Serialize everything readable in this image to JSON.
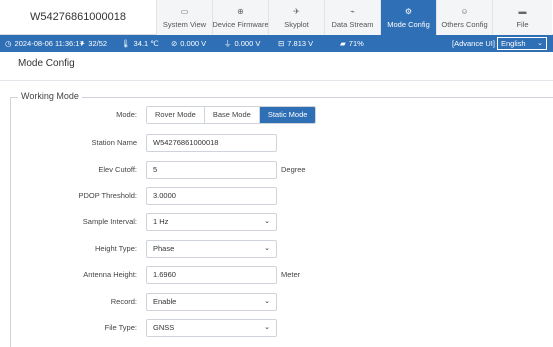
{
  "header": {
    "device_id": "W54276861000018",
    "tabs": [
      {
        "label": "System View",
        "icon": "monitor-icon",
        "glyph": "▭"
      },
      {
        "label": "Device Firmware",
        "icon": "firmware-icon",
        "glyph": "⊕"
      },
      {
        "label": "Skyplot",
        "icon": "satellite-icon",
        "glyph": "✈"
      },
      {
        "label": "Data Stream",
        "icon": "stream-icon",
        "glyph": "⌁"
      },
      {
        "label": "Mode Config",
        "icon": "gear-icon",
        "glyph": "⚙"
      },
      {
        "label": "Others Config",
        "icon": "settings-icon",
        "glyph": "☺"
      },
      {
        "label": "File",
        "icon": "folder-icon",
        "glyph": "▬"
      }
    ],
    "active_tab": "Mode Config"
  },
  "status": {
    "datetime": "2024-08-06 11:36:17",
    "satellites": "32/52",
    "temperature": "34.1 ℃",
    "voltage1": "0.000 V",
    "voltage2": "0.000 V",
    "voltage3": "7.813 V",
    "battery": "71%",
    "advance_ui": "[Advance UI]",
    "language": "English"
  },
  "page": {
    "title": "Mode Config",
    "group_label": "Working Mode"
  },
  "form": {
    "mode": {
      "label": "Mode:",
      "options": [
        "Rover Mode",
        "Base Mode",
        "Static Mode"
      ],
      "selected": "Static Mode"
    },
    "station_name": {
      "label": "Station Name",
      "value": "W54276861000018"
    },
    "elev_cutoff": {
      "label": "Elev Cutoff:",
      "value": "5",
      "unit": "Degree"
    },
    "pdop_threshold": {
      "label": "PDOP Threshold:",
      "value": "3.0000"
    },
    "sample_interval": {
      "label": "Sample Interval:",
      "value": "1 Hz"
    },
    "height_type": {
      "label": "Height Type:",
      "value": "Phase"
    },
    "antenna_height": {
      "label": "Antenna Height:",
      "value": "1.6960",
      "unit": "Meter"
    },
    "record": {
      "label": "Record:",
      "value": "Enable"
    },
    "file_type": {
      "label": "File Type:",
      "value": "GNSS"
    }
  },
  "colors": {
    "accent": "#2f6fb5",
    "border": "#cfd4da"
  }
}
